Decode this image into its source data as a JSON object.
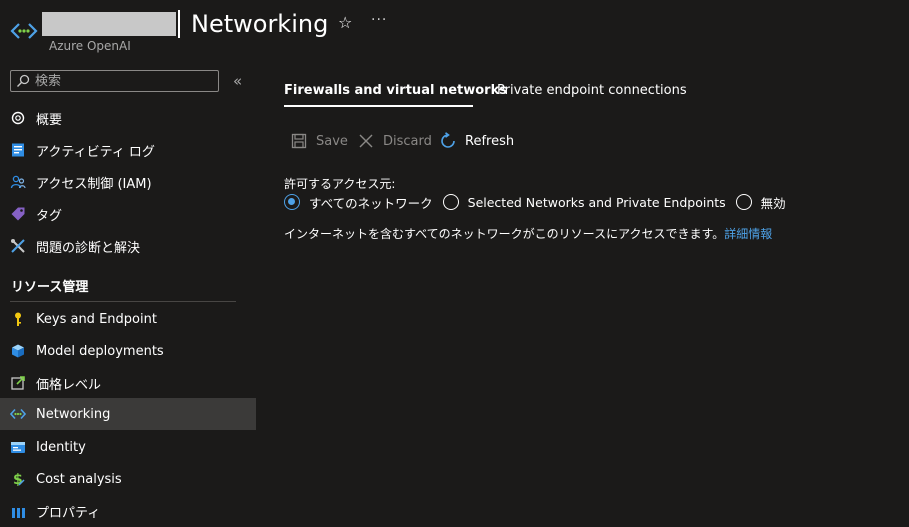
{
  "header": {
    "title": "Networking",
    "subtitle": "Azure OpenAI",
    "star_icon": "star-icon",
    "more_icon": "more-icon",
    "more_label": "···"
  },
  "sidebar": {
    "search": {
      "placeholder": "検索"
    },
    "collapse_label": "«",
    "items": [
      {
        "label": "概要",
        "icon": "openai-icon"
      },
      {
        "label": "アクティビティ ログ",
        "icon": "activity-log-icon"
      },
      {
        "label": "アクセス制御 (IAM)",
        "icon": "access-control-icon"
      },
      {
        "label": "タグ",
        "icon": "tag-icon"
      },
      {
        "label": "問題の診断と解決",
        "icon": "wrench-icon"
      }
    ],
    "section_heading": "リソース管理",
    "section_items": [
      {
        "label": "Keys and Endpoint",
        "icon": "key-icon"
      },
      {
        "label": "Model deployments",
        "icon": "cube-icon"
      },
      {
        "label": "価格レベル",
        "icon": "pricing-tier-icon"
      },
      {
        "label": "Networking",
        "icon": "networking-icon",
        "active": true
      },
      {
        "label": "Identity",
        "icon": "identity-icon"
      },
      {
        "label": "Cost analysis",
        "icon": "cost-analysis-icon"
      },
      {
        "label": "プロパティ",
        "icon": "properties-icon"
      }
    ]
  },
  "main": {
    "tabs": [
      {
        "label": "Firewalls and virtual networks",
        "active": true
      },
      {
        "label": "Private endpoint connections",
        "active": false
      }
    ],
    "toolbar": {
      "save_label": "Save",
      "discard_label": "Discard",
      "refresh_label": "Refresh"
    },
    "access": {
      "label": "許可するアクセス元:",
      "options": [
        {
          "label": "すべてのネットワーク",
          "checked": true
        },
        {
          "label": "Selected Networks and Private Endpoints",
          "checked": false
        },
        {
          "label": "無効",
          "checked": false
        }
      ],
      "info_text": "インターネットを含むすべてのネットワークがこのリソースにアクセスできます。",
      "info_link": "詳細情報"
    }
  },
  "colors": {
    "background": "#1b1a19",
    "accent": "#4ea1e6",
    "active_item": "#3b3a39",
    "disabled_text": "#8a8886"
  }
}
